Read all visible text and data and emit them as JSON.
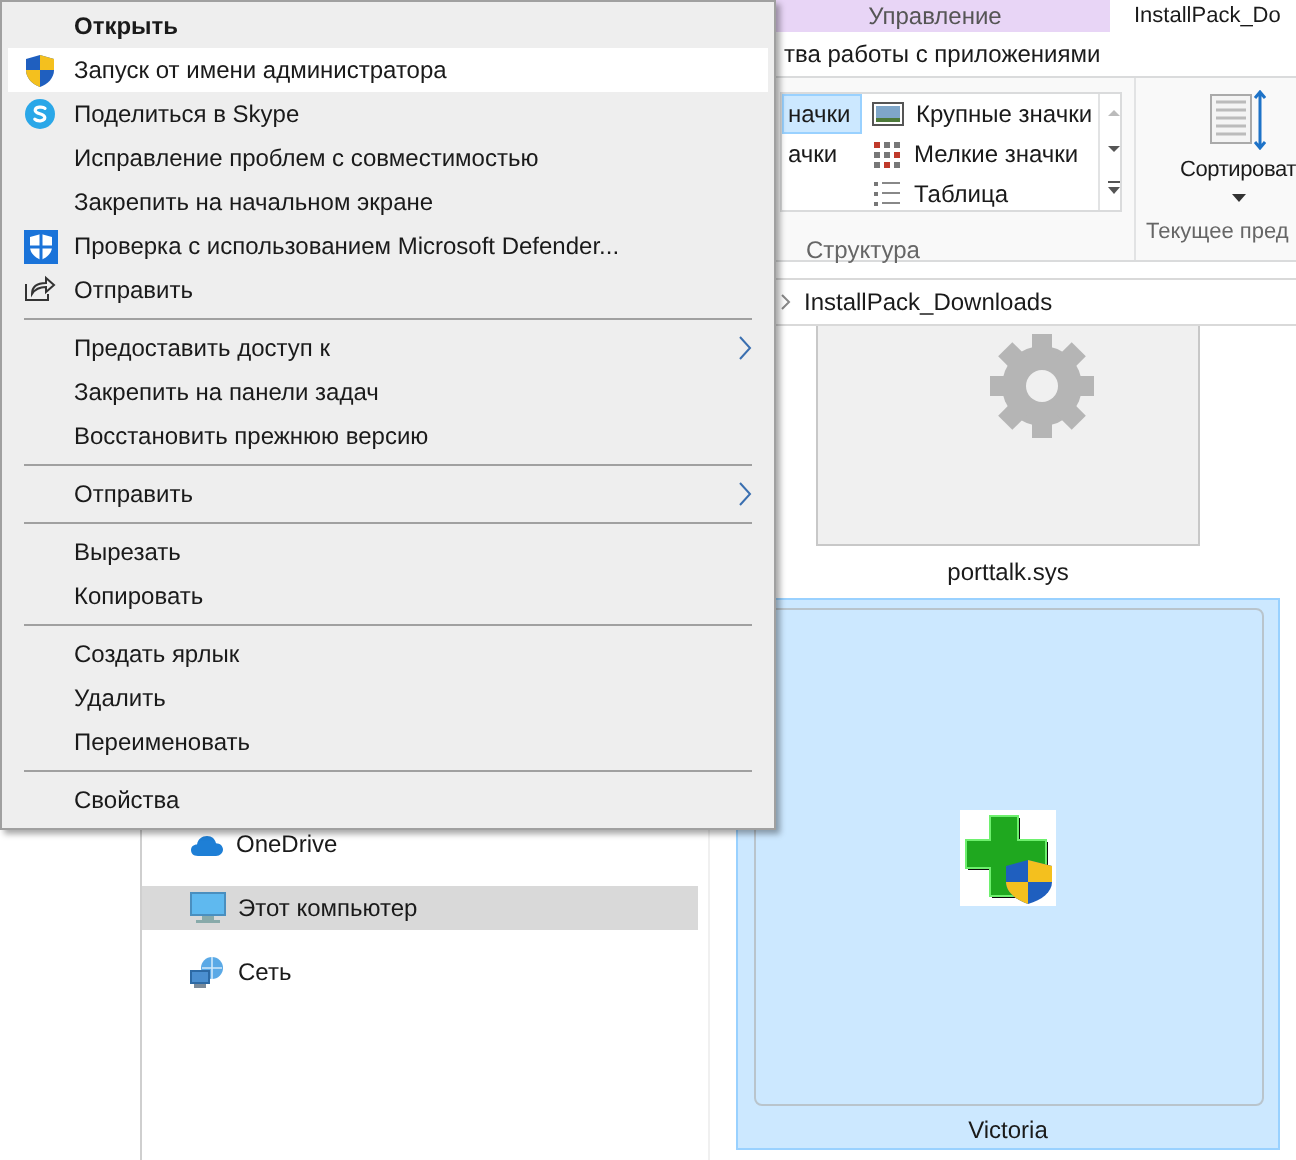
{
  "window": {
    "title": "InstallPack_Do"
  },
  "ribbon": {
    "context_tab": {
      "label": "Управление",
      "selected": false
    },
    "context_group": "тва работы с приложениями",
    "layout_options": [
      {
        "label": "начки",
        "selected": true
      },
      {
        "label": "ачки",
        "selected": false
      },
      {
        "label": "Крупные значки",
        "selected": false
      },
      {
        "label": "Мелкие значки",
        "selected": false
      },
      {
        "label": "Таблица",
        "selected": false
      }
    ],
    "layout_group": "Структура",
    "sort_button": "Сортироват",
    "view_group": "Текущее пред"
  },
  "address_bar": {
    "path": "InstallPack_Downloads"
  },
  "sidebar": {
    "items": [
      {
        "label": "OneDrive",
        "selected": false
      },
      {
        "label": "Этот компьютер",
        "selected": true
      },
      {
        "label": "Сеть",
        "selected": false
      }
    ]
  },
  "files": [
    {
      "name": "porttalk.sys",
      "selected": false
    },
    {
      "name": "Victoria",
      "selected": true
    }
  ],
  "context_menu": {
    "items": [
      {
        "kind": "item",
        "label": "Открыть",
        "default": true,
        "selected": false,
        "submenu": false
      },
      {
        "kind": "item",
        "label": "Запуск от имени администратора",
        "default": false,
        "selected": true,
        "submenu": false
      },
      {
        "kind": "item",
        "label": "Поделиться в Skype",
        "default": false,
        "selected": false,
        "submenu": false
      },
      {
        "kind": "item",
        "label": "Исправление проблем с совместимостью",
        "default": false,
        "selected": false,
        "submenu": false
      },
      {
        "kind": "item",
        "label": "Закрепить на начальном экране",
        "default": false,
        "selected": false,
        "submenu": false
      },
      {
        "kind": "item",
        "label": "Проверка с использованием Microsoft Defender...",
        "default": false,
        "selected": false,
        "submenu": false
      },
      {
        "kind": "item",
        "label": "Отправить",
        "default": false,
        "selected": false,
        "submenu": false
      },
      {
        "kind": "separator"
      },
      {
        "kind": "item",
        "label": "Предоставить доступ к",
        "default": false,
        "selected": false,
        "submenu": true
      },
      {
        "kind": "item",
        "label": "Закрепить на панели задач",
        "default": false,
        "selected": false,
        "submenu": false
      },
      {
        "kind": "item",
        "label": "Восстановить прежнюю версию",
        "default": false,
        "selected": false,
        "submenu": false
      },
      {
        "kind": "separator"
      },
      {
        "kind": "item",
        "label": "Отправить",
        "default": false,
        "selected": false,
        "submenu": true
      },
      {
        "kind": "separator"
      },
      {
        "kind": "item",
        "label": "Вырезать",
        "default": false,
        "selected": false,
        "submenu": false
      },
      {
        "kind": "item",
        "label": "Копировать",
        "default": false,
        "selected": false,
        "submenu": false
      },
      {
        "kind": "separator"
      },
      {
        "kind": "item",
        "label": "Создать ярлык",
        "default": false,
        "selected": false,
        "submenu": false
      },
      {
        "kind": "item",
        "label": "Удалить",
        "default": false,
        "selected": false,
        "submenu": false
      },
      {
        "kind": "item",
        "label": "Переименовать",
        "default": false,
        "selected": false,
        "submenu": false
      },
      {
        "kind": "separator"
      },
      {
        "kind": "item",
        "label": "Свойства",
        "default": false,
        "selected": false,
        "submenu": false
      }
    ]
  }
}
